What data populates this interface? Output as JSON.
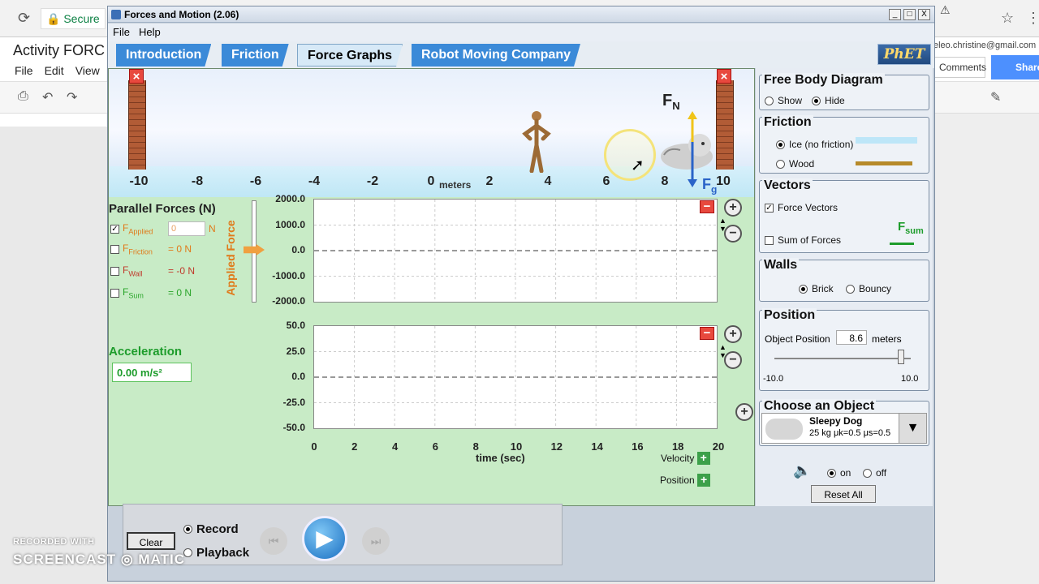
{
  "browser": {
    "secure_label": "Secure",
    "doc_title": "Activity FORC",
    "doc_menu": [
      "File",
      "Edit",
      "View"
    ],
    "email": "eleo.christine@gmail.com",
    "comments_label": "Comments",
    "share_label": "Share"
  },
  "window": {
    "title": "Forces and Motion (2.06)",
    "controls": [
      "_",
      "□",
      "X"
    ]
  },
  "menu": {
    "file": "File",
    "help": "Help"
  },
  "tabs": [
    {
      "label": "Introduction",
      "active": false
    },
    {
      "label": "Friction",
      "active": false
    },
    {
      "label": "Force Graphs",
      "active": true
    },
    {
      "label": "Robot Moving Company",
      "active": false
    }
  ],
  "phet_logo": "PhET",
  "scene": {
    "axis_ticks": [
      "-10",
      "-8",
      "-6",
      "-4",
      "-2",
      "0",
      "2",
      "4",
      "6",
      "8",
      "10"
    ],
    "axis_unit": "meters",
    "normal_force_label": "F",
    "normal_force_sub": "N",
    "gravity_force_label": "F",
    "gravity_force_sub": "g"
  },
  "parallel_forces": {
    "title": "Parallel Forces (N)",
    "applied_label": "F",
    "applied_sub": "Applied",
    "applied_value": "0",
    "applied_unit": "N",
    "rows": [
      {
        "label": "F",
        "sub": "Friction",
        "value": "= 0 N",
        "color": "#e07a1a"
      },
      {
        "label": "F",
        "sub": "Wall",
        "value": "= -0 N",
        "color": "#c0392b"
      },
      {
        "label": "F",
        "sub": "Sum",
        "value": "= 0 N",
        "color": "#2aa52a"
      }
    ],
    "vertical_label": "Applied Force"
  },
  "force_graph": {
    "y_ticks": [
      "2000.0",
      "1000.0",
      "0.0",
      "-1000.0",
      "-2000.0"
    ]
  },
  "accel_graph": {
    "y_ticks": [
      "50.0",
      "25.0",
      "0.0",
      "-25.0",
      "-50.0"
    ]
  },
  "acceleration": {
    "label": "Acceleration",
    "value": "0.00 m/s²"
  },
  "time_axis": {
    "ticks": [
      "0",
      "2",
      "4",
      "6",
      "8",
      "10",
      "12",
      "14",
      "16",
      "18",
      "20"
    ],
    "label": "time (sec)"
  },
  "extra_graphs": {
    "velocity": "Velocity",
    "position": "Position"
  },
  "free_body": {
    "title": "Free Body Diagram",
    "show": "Show",
    "hide": "Hide",
    "selected": "hide"
  },
  "friction": {
    "title": "Friction",
    "ice": "Ice (no friction)",
    "wood": "Wood",
    "selected": "ice"
  },
  "vectors": {
    "title": "Vectors",
    "force_vectors": "Force Vectors",
    "force_vectors_checked": true,
    "sum_of_forces": "Sum of Forces",
    "sum_checked": false,
    "fsum_label": "F",
    "fsum_sub": "sum"
  },
  "walls": {
    "title": "Walls",
    "brick": "Brick",
    "bouncy": "Bouncy",
    "selected": "brick"
  },
  "position": {
    "title": "Position",
    "label": "Object Position",
    "value": "8.6",
    "unit": "meters",
    "min_label": "-10.0",
    "max_label": "10.0",
    "slider_value": 8.6
  },
  "object": {
    "title": "Choose an Object",
    "name": "Sleepy Dog",
    "details": "25 kg μk=0.5 μs=0.5"
  },
  "sound": {
    "on": "on",
    "off": "off",
    "selected": "on"
  },
  "reset_label": "Reset All",
  "playback": {
    "clear": "Clear",
    "record": "Record",
    "playback": "Playback",
    "selected": "record"
  },
  "watermark": {
    "line1": "RECORDED WITH",
    "line2": "SCREENCAST ◎ MATIC"
  }
}
